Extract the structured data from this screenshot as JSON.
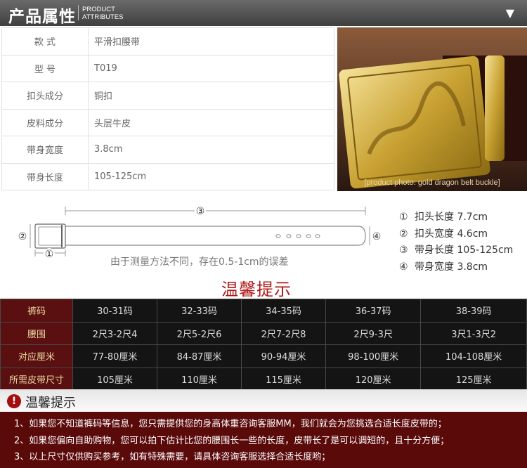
{
  "header": {
    "title": "产品属性",
    "subtitle_line1": "PRODUCT",
    "subtitle_line2": "ATTRIBUTES",
    "toggle_icon": "triangle-down-icon"
  },
  "attributes": [
    {
      "key": "款 式",
      "value": "平滑扣腰带"
    },
    {
      "key": "型 号",
      "value": "T019"
    },
    {
      "key": "扣头成分",
      "value": "铜扣"
    },
    {
      "key": "皮料成分",
      "value": "头层牛皮"
    },
    {
      "key": "带身宽度",
      "value": "3.8cm"
    },
    {
      "key": "带身长度",
      "value": "105-125cm"
    }
  ],
  "photo": {
    "label": "[product photo: gold dragon belt buckle]"
  },
  "diagram": {
    "marker_1": "①",
    "marker_2": "②",
    "marker_3": "③",
    "marker_4": "④",
    "note": "由于测量方法不同，存在0.5-1cm的误差"
  },
  "legend": [
    {
      "num": "①",
      "text": "扣头长度 7.7cm"
    },
    {
      "num": "②",
      "text": "扣头宽度 4.6cm"
    },
    {
      "num": "③",
      "text": "带身长度 105-125cm"
    },
    {
      "num": "④",
      "text": "带身宽度 3.8cm"
    }
  ],
  "tip_title": "温馨提示",
  "size_table": {
    "rows": [
      {
        "header": "裤码",
        "cells": [
          "30-31码",
          "32-33码",
          "34-35码",
          "36-37码",
          "38-39码"
        ]
      },
      {
        "header": "腰围",
        "cells": [
          "2尺3-2尺4",
          "2尺5-2尺6",
          "2尺7-2尺8",
          "2尺9-3尺",
          "3尺1-3尺2"
        ]
      },
      {
        "header": "对应厘米",
        "cells": [
          "77-80厘米",
          "84-87厘米",
          "90-94厘米",
          "98-100厘米",
          "104-108厘米"
        ]
      },
      {
        "header": "所需皮带尺寸",
        "cells": [
          "105厘米",
          "110厘米",
          "115厘米",
          "120厘米",
          "125厘米"
        ]
      }
    ]
  },
  "notice": {
    "icon_text": "!",
    "title": "温馨提示",
    "lines": [
      "1、如果您不知道裤码等信息，您只需提供您的身高体重咨询客服MM，我们就会为您挑选合适长度皮带的；",
      "2、如果您偏向自助购物，您可以拍下估计比您的腰围长一些的长度，皮带长了是可以调短的，且十分方便；",
      "3、以上尺寸仅供购买参考，如有特殊需要，请具体咨询客服选择合适长度哟；"
    ]
  },
  "colors": {
    "header_bg": "#4f4f4f",
    "accent_red": "#b01818",
    "table_header_bg": "#5a1010",
    "table_header_text": "#e9d6a0",
    "table_body_bg": "#141414",
    "notice_bg": "#5b0a0a"
  }
}
